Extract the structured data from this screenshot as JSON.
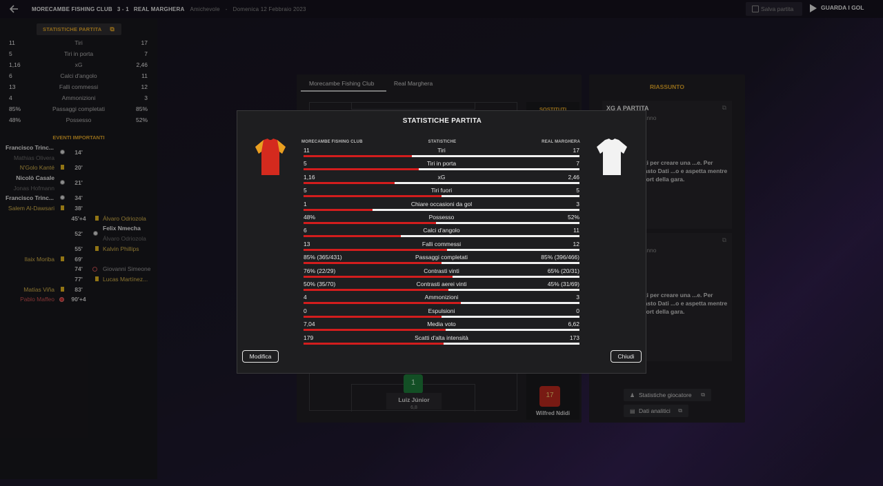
{
  "header": {
    "home_team": "MORECAMBE FISHING CLUB",
    "score": "3 - 1",
    "away_team": "REAL MARGHERA",
    "competition": "Amichevole",
    "separator": "-",
    "date": "Domenica 12 Febbraio 2023",
    "save_label": "Salva partita",
    "watch_label": "GUARDA I GOL"
  },
  "left_panel": {
    "stats_tab_label": "STATISTICHE PARTITA",
    "stats": [
      {
        "a": "11",
        "name": "Tiri",
        "b": "17"
      },
      {
        "a": "5",
        "name": "Tiri in porta",
        "b": "7"
      },
      {
        "a": "1,16",
        "name": "xG",
        "b": "2,46"
      },
      {
        "a": "6",
        "name": "Calci d'angolo",
        "b": "11"
      },
      {
        "a": "13",
        "name": "Falli commessi",
        "b": "12"
      },
      {
        "a": "4",
        "name": "Ammonizioni",
        "b": "3"
      },
      {
        "a": "85%",
        "name": "Passaggi completati",
        "b": "85%"
      },
      {
        "a": "48%",
        "name": "Possesso",
        "b": "52%"
      }
    ],
    "events_title": "EVENTI IMPORTANTI",
    "events": {
      "e1_player": "Francisco Trinc...",
      "e1_assist": "Mathias Olivera",
      "e1_min": "14'",
      "e2_player": "N'Golo Kanté",
      "e2_min": "20'",
      "e3_player": "Nicolò Casale",
      "e3_assist": "Jonas Hofmann",
      "e3_min": "21'",
      "e4_player": "Francisco Trinc...",
      "e4_min": "34'",
      "e5_player": "Salem Al-Dawsari",
      "e5_min": "38'",
      "e6_min": "45'+4",
      "e6_player": "Álvaro Odriozola",
      "e7_min": "52'",
      "e7_player": "Felix Nmecha",
      "e7_assist": "Álvaro Odriozola",
      "e8_min": "55'",
      "e8_player": "Kalvin Phillips",
      "e9_player": "Ilaix Moriba",
      "e9_min": "69'",
      "e10_min": "74'",
      "e10_player": "Giovanni Simeone",
      "e11_min": "77'",
      "e11_player": "Lucas Martínez...",
      "e12_player": "Matías Viña",
      "e12_min": "83'",
      "e13_player": "Pablo Maffeo",
      "e13_min": "90'+4"
    }
  },
  "center": {
    "tab_home": "Morecambe Fishing Club",
    "tab_away": "Real Marghera",
    "subs_title": "SOSTITUTI",
    "gk_number": "1",
    "gk_name": "Luiz Júnior",
    "gk_rating": "6,8",
    "sub_number": "17",
    "sub_name": "Wilfred Ndidi"
  },
  "right_panel": {
    "title": "RIASSUNTO",
    "card1_title": "XG A PARTITA",
    "card1_sub": "...zioni, Quest'anno",
    "card1_msg": "...bastanza dati per creare una ...e. Per favore usa il tasto Dati ...o e aspetta mentre genera il ...report della gara.",
    "card2_sub": "...zioni, Quest'anno",
    "card2_msg": "...bastanza dati per creare una ...e. Per favore usa il tasto Dati ...o e aspetta mentre genera il ...report della gara.",
    "btn_player_stats": "Statistiche giocatore",
    "btn_analytics": "Dati analitici"
  },
  "modal": {
    "title": "STATISTICHE PARTITA",
    "col_home": "MORECAMBE FISHING CLUB",
    "col_mid": "STATISTICHE",
    "col_away": "REAL MARGHERA",
    "edit_label": "Modifica",
    "close_label": "Chiudi",
    "home_shirt_colors": [
      "#d42a1e",
      "#e8a020"
    ],
    "away_shirt_color": "#f2f2f2",
    "stats": [
      {
        "a": "11",
        "name": "Tiri",
        "b": "17",
        "home_share": 0.393
      },
      {
        "a": "5",
        "name": "Tiri in porta",
        "b": "7",
        "home_share": 0.417
      },
      {
        "a": "1,16",
        "name": "xG",
        "b": "2,46",
        "home_share": 0.33
      },
      {
        "a": "5",
        "name": "Tiri fuori",
        "b": "5",
        "home_share": 0.5
      },
      {
        "a": "1",
        "name": "Chiare occasioni da gol",
        "b": "3",
        "home_share": 0.25
      },
      {
        "a": "48%",
        "name": "Possesso",
        "b": "52%",
        "home_share": 0.48
      },
      {
        "a": "6",
        "name": "Calci d'angolo",
        "b": "11",
        "home_share": 0.353
      },
      {
        "a": "13",
        "name": "Falli commessi",
        "b": "12",
        "home_share": 0.52
      },
      {
        "a": "85% (365/431)",
        "name": "Passaggi completati",
        "b": "85% (396/466)",
        "home_share": 0.5
      },
      {
        "a": "76% (22/29)",
        "name": "Contrasti vinti",
        "b": "65% (20/31)",
        "home_share": 0.539
      },
      {
        "a": "50% (35/70)",
        "name": "Contrasti aerei vinti",
        "b": "45% (31/69)",
        "home_share": 0.526
      },
      {
        "a": "4",
        "name": "Ammonizioni",
        "b": "3",
        "home_share": 0.571
      },
      {
        "a": "0",
        "name": "Espulsioni",
        "b": "0",
        "home_share": 0.5
      },
      {
        "a": "7,04",
        "name": "Media voto",
        "b": "6,62",
        "home_share": 0.515
      },
      {
        "a": "179",
        "name": "Scatti d'alta intensità",
        "b": "173",
        "home_share": 0.508
      }
    ]
  }
}
